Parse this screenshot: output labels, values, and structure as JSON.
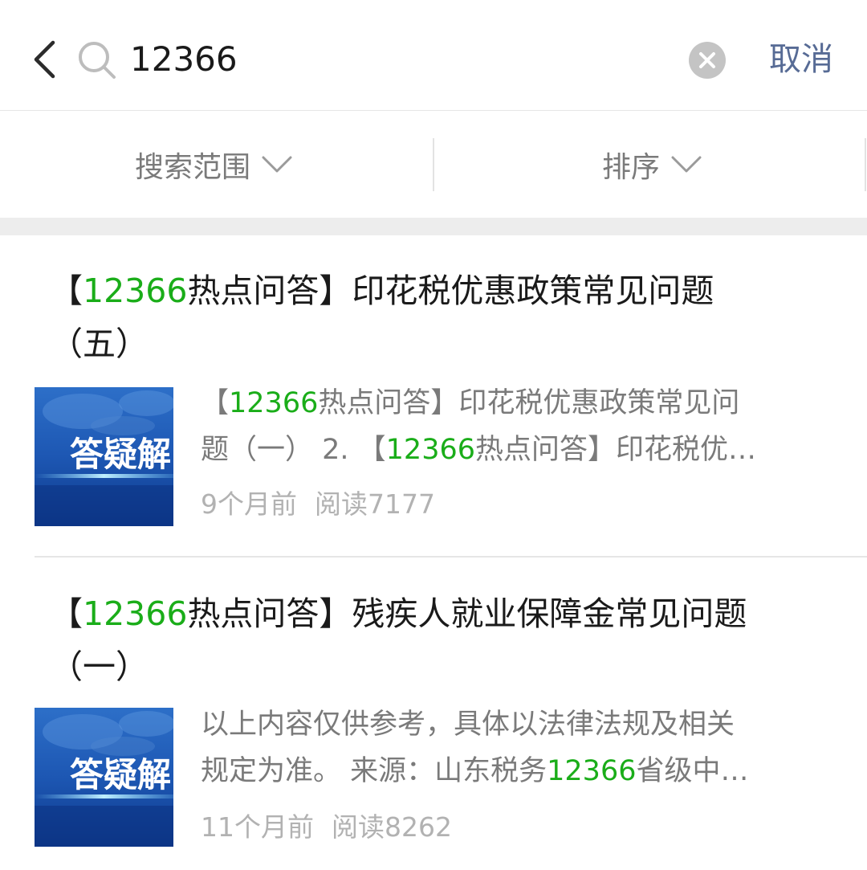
{
  "search": {
    "query": "12366",
    "cancel_label": "取消"
  },
  "filters": {
    "scope_label": "搜索范围",
    "sort_label": "排序"
  },
  "thumbnail_text": "答疑解",
  "results": [
    {
      "title_open": "【",
      "title_hl": "12366",
      "title_rest": "热点问答】印花税优惠政策常见问题",
      "title_line2": "（五）",
      "snippet_line1_pre": "【",
      "snippet_line1_hl": "12366",
      "snippet_line1_post": "热点问答】印花税优惠政策常见问",
      "snippet_line2_pre": "题（一） 2. 【",
      "snippet_line2_hl": "12366",
      "snippet_line2_post": "热点问答】印花税优…",
      "time": "9个月前",
      "reads": "阅读7177"
    },
    {
      "title_open": "【",
      "title_hl": "12366",
      "title_rest": "热点问答】残疾人就业保障金常见问题",
      "title_line2": "（一）",
      "snippet_line1": "以上内容仅供参考，具体以法律法规及相关",
      "snippet_line2_pre": "规定为准。 来源：山东税务",
      "snippet_line2_hl": "12366",
      "snippet_line2_post": "省级中…",
      "time": "11个月前",
      "reads": "阅读8262"
    }
  ],
  "colors": {
    "highlight": "#1aad19",
    "link": "#576b95",
    "muted": "#7a7a7a",
    "meta": "#b2b2b2"
  },
  "icons": {
    "back": "chevron-left-icon",
    "search": "search-icon",
    "clear": "clear-icon",
    "dropdown": "chevron-down-icon"
  }
}
